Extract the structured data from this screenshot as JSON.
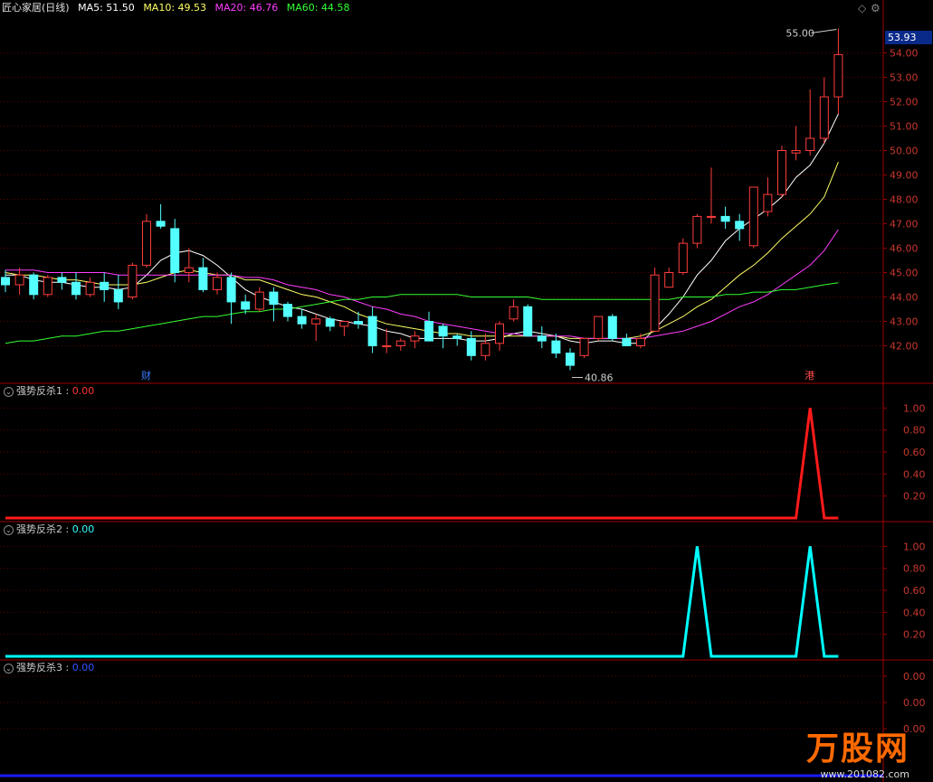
{
  "header": {
    "title": "匠心家居(日线)",
    "ma5": "MA5: 51.50",
    "ma10": "MA10: 49.53",
    "ma20": "MA20: 46.76",
    "ma60": "MA60: 44.58"
  },
  "colors": {
    "up": "#ff3d3d",
    "down": "#54ffff",
    "ma5": "#ffffff",
    "ma10": "#ffff66",
    "ma20": "#ff3dff",
    "ma60": "#33ff33",
    "grid": "#5a0000",
    "axis": "#a00000"
  },
  "current_price": "53.93",
  "marker_high": "55.00",
  "marker_low": "40.86",
  "event_labels": [
    "财",
    "港"
  ],
  "panels": [
    {
      "label": "强势反杀1",
      "value": "0.00",
      "color": "#ff1a1a"
    },
    {
      "label": "强势反杀2",
      "value": "0.00",
      "color": "#00ffff"
    },
    {
      "label": "强势反杀3",
      "value": "0.00",
      "color": "#1a1aff"
    }
  ],
  "watermark": {
    "logo": "万股网",
    "url": "www.201082.com"
  },
  "chart_data": [
    {
      "type": "candlestick",
      "title": "匠心家居(日线)",
      "ylim": [
        40.5,
        55.5
      ],
      "yticks": [
        "42.00",
        "43.00",
        "44.00",
        "45.00",
        "46.00",
        "47.00",
        "48.00",
        "49.00",
        "50.00",
        "51.00",
        "52.00",
        "53.00",
        "54.00"
      ],
      "candles": [
        [
          44.8,
          45.1,
          44.2,
          44.5
        ],
        [
          44.5,
          45.2,
          44.1,
          44.9
        ],
        [
          44.9,
          45.0,
          43.9,
          44.1
        ],
        [
          44.1,
          44.9,
          44.0,
          44.8
        ],
        [
          44.8,
          45.0,
          44.3,
          44.6
        ],
        [
          44.6,
          45.0,
          43.9,
          44.1
        ],
        [
          44.1,
          44.8,
          44.0,
          44.6
        ],
        [
          44.6,
          45.0,
          43.8,
          44.3
        ],
        [
          44.3,
          44.9,
          43.5,
          43.8
        ],
        [
          44.0,
          45.4,
          43.9,
          45.3
        ],
        [
          45.3,
          47.4,
          45.2,
          47.1
        ],
        [
          47.1,
          47.8,
          46.8,
          46.9
        ],
        [
          46.8,
          47.2,
          44.6,
          45.0
        ],
        [
          45.0,
          46.0,
          44.6,
          45.2
        ],
        [
          45.2,
          45.6,
          44.2,
          44.3
        ],
        [
          44.3,
          45.0,
          44.1,
          44.8
        ],
        [
          44.8,
          45.0,
          42.9,
          43.8
        ],
        [
          43.8,
          44.1,
          43.3,
          43.5
        ],
        [
          43.5,
          44.4,
          43.4,
          44.2
        ],
        [
          44.2,
          44.4,
          43.0,
          43.7
        ],
        [
          43.7,
          43.8,
          43.0,
          43.2
        ],
        [
          43.2,
          43.5,
          42.7,
          42.9
        ],
        [
          42.9,
          43.3,
          42.2,
          43.1
        ],
        [
          43.1,
          43.2,
          42.6,
          42.8
        ],
        [
          42.8,
          43.0,
          42.4,
          43.0
        ],
        [
          43.0,
          43.4,
          42.7,
          42.9
        ],
        [
          43.2,
          43.6,
          41.7,
          42.0
        ],
        [
          42.0,
          42.7,
          41.7,
          42.0
        ],
        [
          42.0,
          42.3,
          41.8,
          42.2
        ],
        [
          42.2,
          42.6,
          41.9,
          42.4
        ],
        [
          43.0,
          43.4,
          42.6,
          42.2
        ],
        [
          42.8,
          42.9,
          41.9,
          42.4
        ],
        [
          42.4,
          42.5,
          42.0,
          42.3
        ],
        [
          42.3,
          42.6,
          41.4,
          41.6
        ],
        [
          41.6,
          42.5,
          41.4,
          42.1
        ],
        [
          42.1,
          43.0,
          41.8,
          42.9
        ],
        [
          43.1,
          43.9,
          43.0,
          43.6
        ],
        [
          43.6,
          43.7,
          42.4,
          42.4
        ],
        [
          42.4,
          42.8,
          41.9,
          42.2
        ],
        [
          42.2,
          42.5,
          41.5,
          41.7
        ],
        [
          41.7,
          41.9,
          41.0,
          41.2
        ],
        [
          41.6,
          42.3,
          41.5,
          42.3
        ],
        [
          42.3,
          43.2,
          42.2,
          43.2
        ],
        [
          43.2,
          43.3,
          42.2,
          42.3
        ],
        [
          42.3,
          42.5,
          42.0,
          42.0
        ],
        [
          42.0,
          42.5,
          41.9,
          42.3
        ],
        [
          42.6,
          45.2,
          42.6,
          44.9
        ],
        [
          44.4,
          45.2,
          44.4,
          45.0
        ],
        [
          45.0,
          46.4,
          44.9,
          46.2
        ],
        [
          46.2,
          47.4,
          46.0,
          47.3
        ],
        [
          47.3,
          49.3,
          47.0,
          47.3
        ],
        [
          47.3,
          47.7,
          46.8,
          47.1
        ],
        [
          47.1,
          47.4,
          46.3,
          46.8
        ],
        [
          46.1,
          48.5,
          46.0,
          48.5
        ],
        [
          47.5,
          48.9,
          47.3,
          48.2
        ],
        [
          48.2,
          50.2,
          48.1,
          50.0
        ],
        [
          49.9,
          51.0,
          49.6,
          50.0
        ],
        [
          50.0,
          52.5,
          49.8,
          50.5
        ],
        [
          50.5,
          53.0,
          50.3,
          52.2
        ],
        [
          52.2,
          55.0,
          51.5,
          53.93
        ]
      ],
      "series": [
        {
          "name": "MA5",
          "values": [
            44.9,
            44.9,
            44.7,
            44.6,
            44.6,
            44.5,
            44.4,
            44.4,
            44.3,
            44.4,
            44.9,
            45.5,
            45.8,
            45.9,
            45.7,
            45.3,
            44.8,
            44.3,
            44.0,
            43.8,
            43.6,
            43.5,
            43.3,
            43.1,
            43.0,
            42.9,
            42.8,
            42.6,
            42.5,
            42.3,
            42.3,
            42.3,
            42.3,
            42.2,
            42.2,
            42.3,
            42.5,
            42.6,
            42.5,
            42.4,
            42.2,
            42.1,
            42.2,
            42.2,
            42.1,
            42.1,
            42.7,
            43.3,
            44.0,
            44.9,
            45.5,
            46.3,
            46.8,
            47.2,
            47.6,
            48.1,
            48.9,
            49.4,
            50.3,
            51.5
          ]
        },
        {
          "name": "MA10",
          "values": [
            45.0,
            44.9,
            44.9,
            44.8,
            44.7,
            44.7,
            44.6,
            44.5,
            44.5,
            44.5,
            44.6,
            44.8,
            45.0,
            45.1,
            45.0,
            44.9,
            44.9,
            44.7,
            44.7,
            44.5,
            44.3,
            44.1,
            44.0,
            43.8,
            43.6,
            43.3,
            43.1,
            42.9,
            42.8,
            42.7,
            42.6,
            42.5,
            42.5,
            42.4,
            42.4,
            42.4,
            42.4,
            42.4,
            42.4,
            42.4,
            42.3,
            42.3,
            42.3,
            42.3,
            42.3,
            42.4,
            42.6,
            42.9,
            43.2,
            43.6,
            43.9,
            44.4,
            44.9,
            45.3,
            45.8,
            46.4,
            46.9,
            47.4,
            48.1,
            49.53
          ]
        },
        {
          "name": "MA20",
          "values": [
            45.1,
            45.1,
            45.1,
            45.0,
            45.0,
            45.0,
            45.0,
            45.0,
            44.9,
            44.9,
            44.9,
            44.9,
            44.9,
            44.9,
            44.9,
            44.9,
            44.9,
            44.8,
            44.8,
            44.7,
            44.5,
            44.4,
            44.3,
            44.1,
            44.0,
            43.8,
            43.6,
            43.5,
            43.3,
            43.2,
            43.0,
            42.9,
            42.8,
            42.7,
            42.6,
            42.5,
            42.5,
            42.4,
            42.4,
            42.4,
            42.4,
            42.3,
            42.3,
            42.3,
            42.3,
            42.3,
            42.4,
            42.5,
            42.6,
            42.8,
            43.0,
            43.3,
            43.6,
            43.8,
            44.1,
            44.5,
            44.9,
            45.3,
            45.9,
            46.76
          ]
        },
        {
          "name": "MA60",
          "values": [
            42.1,
            42.2,
            42.2,
            42.3,
            42.4,
            42.4,
            42.5,
            42.6,
            42.6,
            42.7,
            42.8,
            42.9,
            43.0,
            43.1,
            43.2,
            43.2,
            43.3,
            43.4,
            43.4,
            43.5,
            43.5,
            43.6,
            43.7,
            43.8,
            43.9,
            43.9,
            44.0,
            44.0,
            44.1,
            44.1,
            44.1,
            44.1,
            44.1,
            44.0,
            44.0,
            44.0,
            44.0,
            44.0,
            43.9,
            43.9,
            43.9,
            43.9,
            43.9,
            43.9,
            43.9,
            43.9,
            43.9,
            43.9,
            44.0,
            44.0,
            44.0,
            44.1,
            44.1,
            44.2,
            44.2,
            44.3,
            44.3,
            44.4,
            44.5,
            44.58
          ]
        }
      ]
    },
    {
      "type": "line",
      "title": "强势反杀1",
      "ylim": [
        0,
        1.2
      ],
      "yticks": [
        "0.20",
        "0.40",
        "0.60",
        "0.80",
        "1.00"
      ],
      "spikes": [
        57
      ]
    },
    {
      "type": "line",
      "title": "强势反杀2",
      "ylim": [
        0,
        1.2
      ],
      "yticks": [
        "0.20",
        "0.40",
        "0.60",
        "0.80",
        "1.00"
      ],
      "spikes": [
        49,
        57
      ]
    },
    {
      "type": "line",
      "title": "强势反杀3",
      "ylim": [
        -1,
        1
      ],
      "yticks": [
        "0.00",
        "0.00",
        "0.00"
      ],
      "spikes": []
    }
  ]
}
